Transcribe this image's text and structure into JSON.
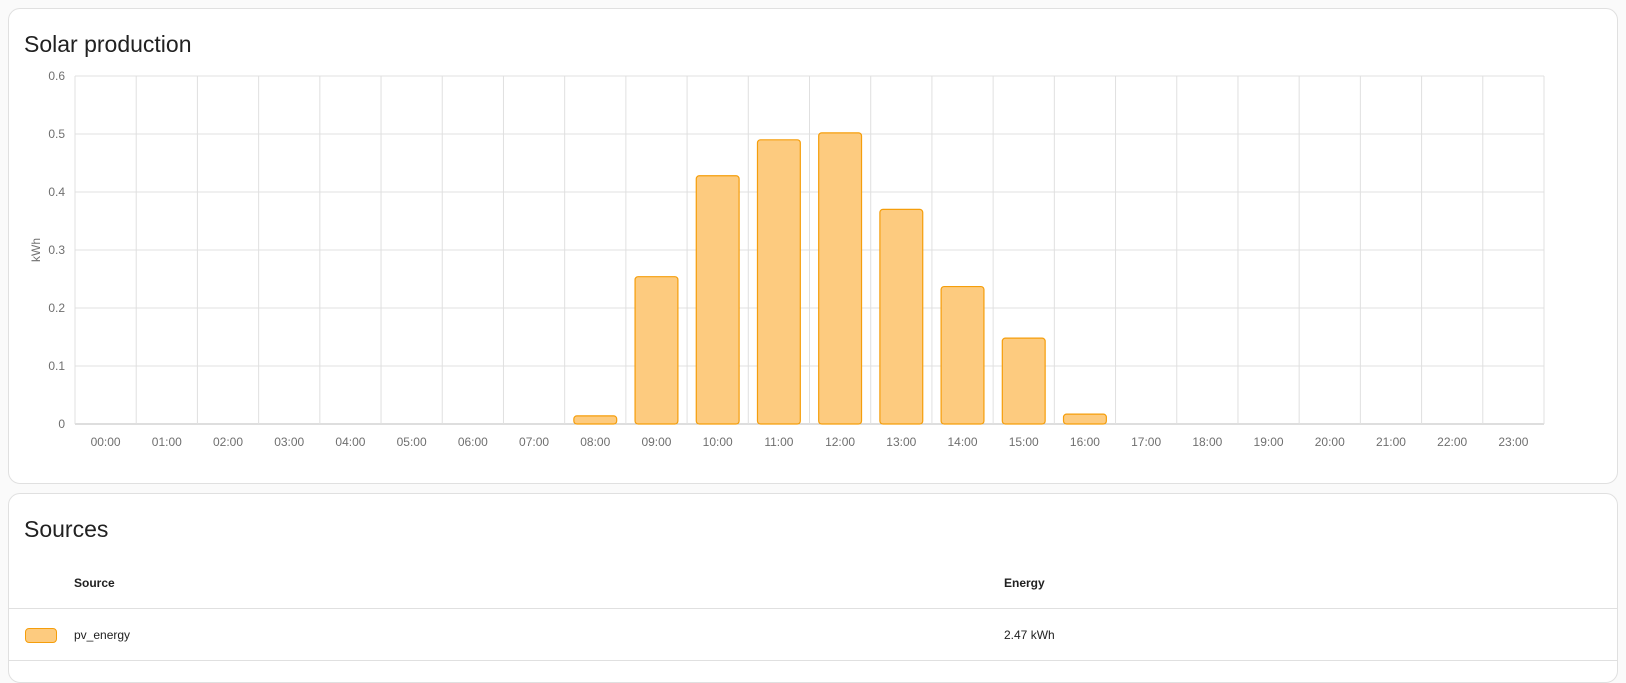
{
  "solar_card": {
    "title": "Solar production"
  },
  "chart_data": {
    "type": "bar",
    "title": "",
    "xlabel": "",
    "ylabel": "kWh",
    "ylim": [
      0,
      0.6
    ],
    "yticks": [
      "0",
      "0.1",
      "0.2",
      "0.3",
      "0.4",
      "0.5",
      "0.6"
    ],
    "grid": true,
    "categories": [
      "00:00",
      "01:00",
      "02:00",
      "03:00",
      "04:00",
      "05:00",
      "06:00",
      "07:00",
      "08:00",
      "09:00",
      "10:00",
      "11:00",
      "12:00",
      "13:00",
      "14:00",
      "15:00",
      "16:00",
      "17:00",
      "18:00",
      "19:00",
      "20:00",
      "21:00",
      "22:00",
      "23:00"
    ],
    "series": [
      {
        "values": [
          0,
          0,
          0,
          0,
          0,
          0,
          0,
          0,
          0.014,
          0.254,
          0.428,
          0.49,
          0.502,
          0.37,
          0.237,
          0.148,
          0.017,
          0,
          0,
          0,
          0,
          0,
          0,
          0
        ],
        "fill": "#fdcb7f",
        "stroke": "#f59e0b"
      }
    ]
  },
  "sources_card": {
    "title": "Sources",
    "columns": [
      "Source",
      "Energy"
    ],
    "rows": [
      {
        "swatch_fill": "#fdcb7f",
        "swatch_stroke": "#f59e0b",
        "source": "pv_energy",
        "energy": "2.47 kWh"
      }
    ]
  }
}
